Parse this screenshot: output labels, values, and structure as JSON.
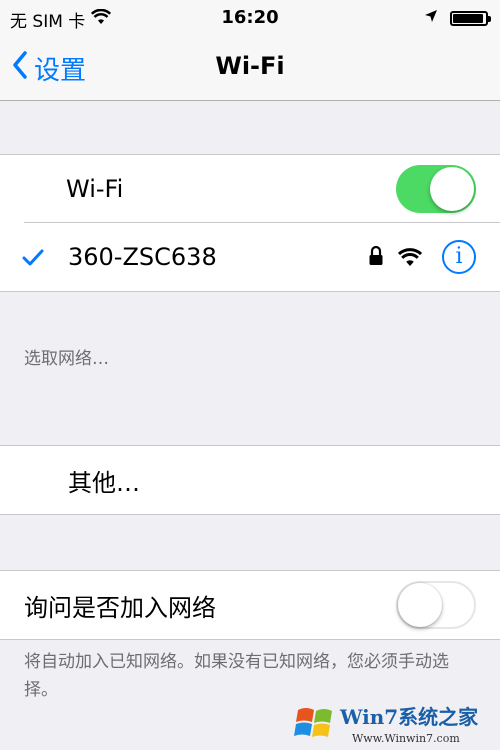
{
  "status": {
    "carrier": "无 SIM 卡",
    "time": "16:20",
    "battery_level": 0.95,
    "icons": [
      "wifi-signal-icon",
      "location-arrow-icon",
      "battery-icon"
    ]
  },
  "nav": {
    "back_label": "设置",
    "title": "Wi-Fi"
  },
  "wifi": {
    "label": "Wi-Fi",
    "enabled": true
  },
  "connected": {
    "name": "360-ZSC638",
    "secured": true
  },
  "choose_header": "选取网络…",
  "other_label": "其他…",
  "ask_join": {
    "label": "询问是否加入网络",
    "enabled": false
  },
  "footer": "将自动加入已知网络。如果没有已知网络，您必须手动选择。",
  "watermark": {
    "brand": "Win7系统之家",
    "url": "Www.Winwin7.com"
  },
  "colors": {
    "accent": "#007aff",
    "toggle_on": "#4cd964",
    "background": "#efeff4"
  }
}
